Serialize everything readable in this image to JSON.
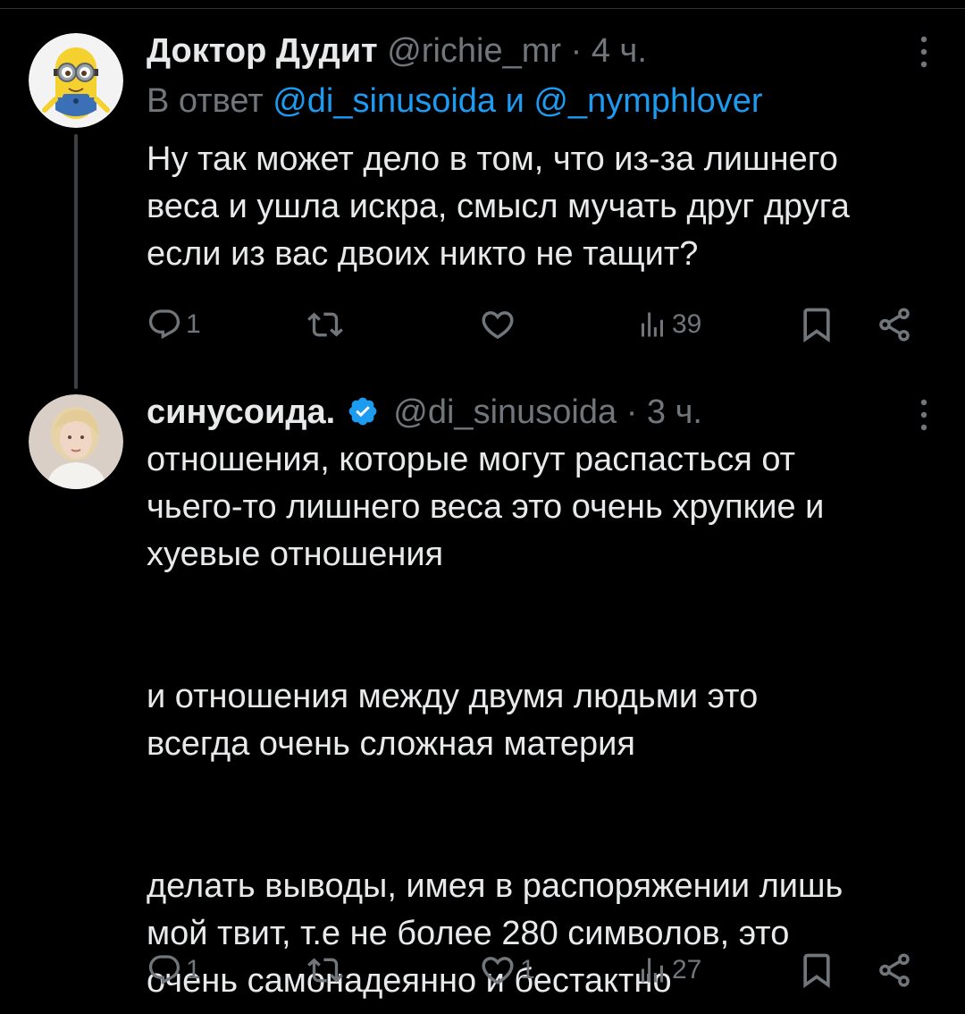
{
  "tweets": [
    {
      "name": "Доктор Дудит",
      "handle": "@richie_mr",
      "separator": "·",
      "time": "4 ч.",
      "reply_prefix": "В ответ",
      "reply_mention_1": "@di_sinusoida",
      "reply_conj": "и",
      "reply_mention_2": "@_nymphlover",
      "text": "Ну так может дело в том, что из-за лишнего\nвеса и ушла искра, смысл мучать друг друга\nесли из вас двоих никто не тащит?",
      "replies": "1",
      "retweets": "",
      "likes": "",
      "views": "39",
      "avatar_icon": "minion-avatar"
    },
    {
      "name": "синусоида.",
      "verified": true,
      "handle": "@di_sinusoida",
      "separator": "·",
      "time": "3 ч.",
      "text": "отношения, которые могут распасться от\nчьего-то лишнего веса это очень хрупкие и\nхуевые отношения\n\n\nи отношения между двумя людьми это\nвсегда очень сложная материя\n\n\nделать выводы, имея в распоряжении лишь\nмой твит, т.е не более 280 символов, это\nочень самонадеянно и бестактно",
      "replies": "1",
      "retweets": "",
      "likes": "1",
      "views": "27",
      "avatar_icon": "woman-portrait-avatar"
    }
  ],
  "colors": {
    "background": "#000000",
    "text": "#e7e9ea",
    "secondary": "#71767b",
    "accent": "#1d9bf0",
    "thread_line": "#3e4144"
  }
}
